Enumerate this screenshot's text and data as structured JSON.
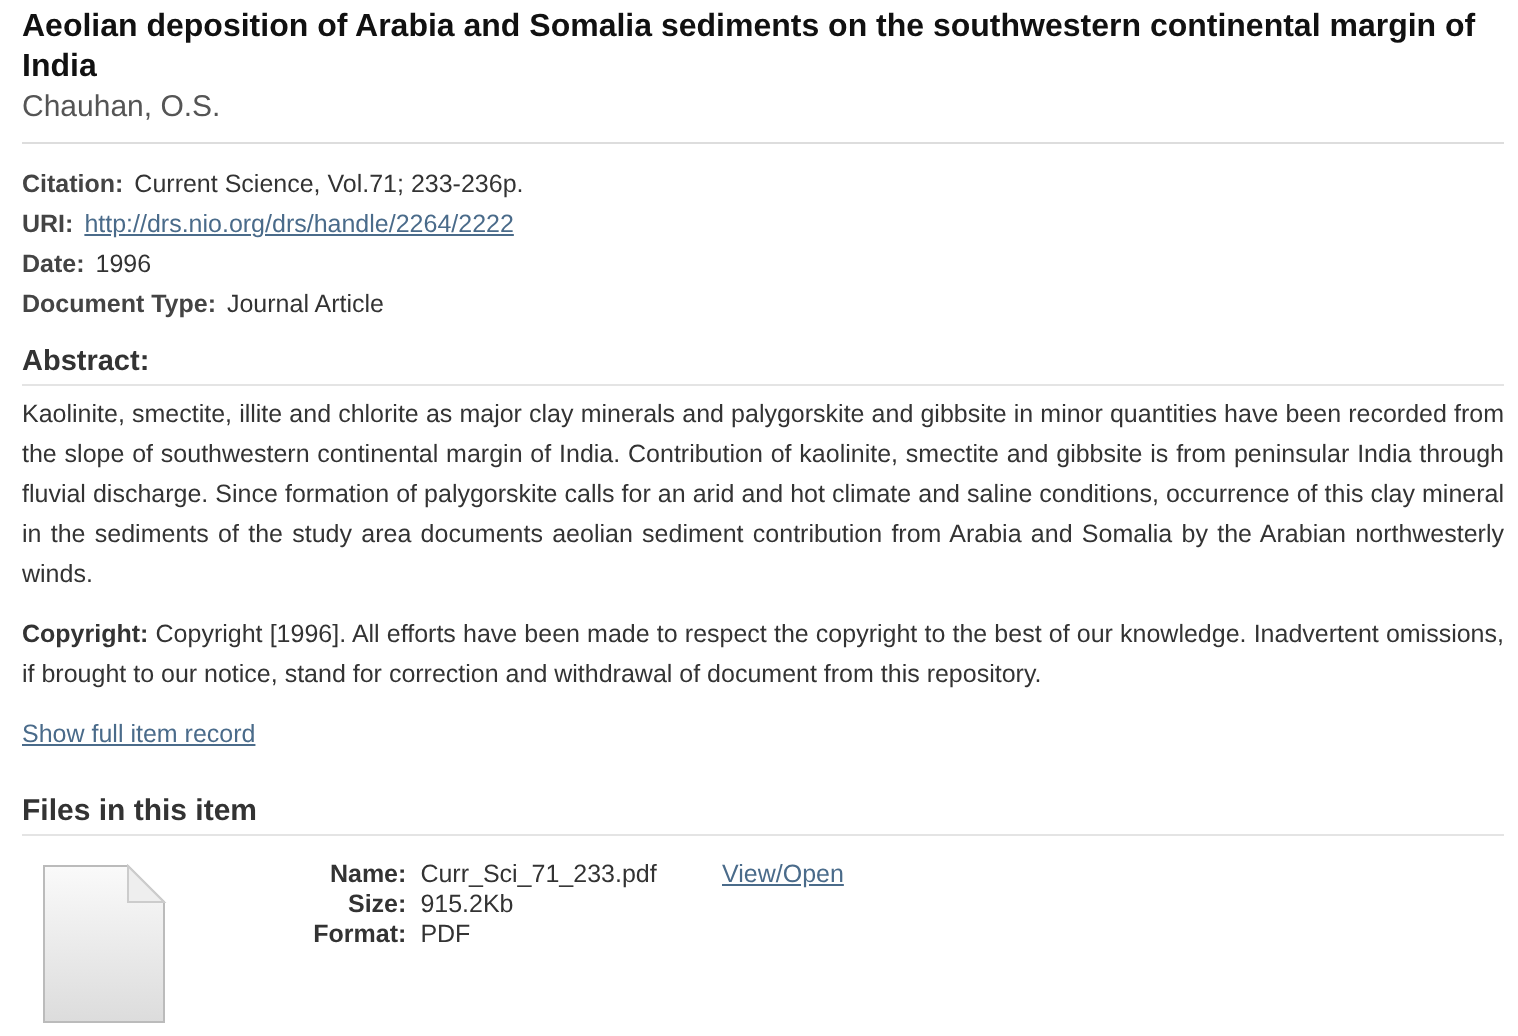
{
  "title": "Aeolian deposition of Arabia and Somalia sediments on the southwestern continental margin of India",
  "author": "Chauhan, O.S.",
  "fields": [
    {
      "label": "Citation:",
      "value": "Current Science, Vol.71; 233-236p.",
      "kind": "text"
    },
    {
      "label": "URI:",
      "value": "http://drs.nio.org/drs/handle/2264/2222",
      "kind": "link"
    },
    {
      "label": "Date:",
      "value": "1996",
      "kind": "text"
    },
    {
      "label": "Document Type:",
      "value": "Journal Article",
      "kind": "text"
    }
  ],
  "abstract": {
    "heading": "Abstract:",
    "text": "Kaolinite, smectite, illite and chlorite as major clay minerals and palygorskite and gibbsite in minor quantities have been recorded from the slope of southwestern continental margin of India. Contribution of kaolinite, smectite and gibbsite is from peninsular India through fluvial discharge. Since formation of palygorskite calls for an arid and hot climate and saline conditions, occurrence of this clay mineral in the sediments of the study area documents aeolian sediment contribution from Arabia and Somalia by the Arabian northwesterly winds."
  },
  "copyright": "**Copyright:** Copyright [1996]. All efforts have been made to respect the copyright to the best of our knowledge. Inadvertent omissions, if brought to our notice, stand for correction and withdrawal of document from this repository.",
  "show_full_record": "Show full item record",
  "files": {
    "heading": "Files in this item",
    "items": [
      {
        "meta": [
          {
            "label": "Name:",
            "value": "Curr_Sci_71_233.pdf"
          },
          {
            "label": "Size:",
            "value": "915.2Kb"
          },
          {
            "label": "Format:",
            "value": "PDF"
          }
        ],
        "action": "View/Open"
      }
    ]
  }
}
